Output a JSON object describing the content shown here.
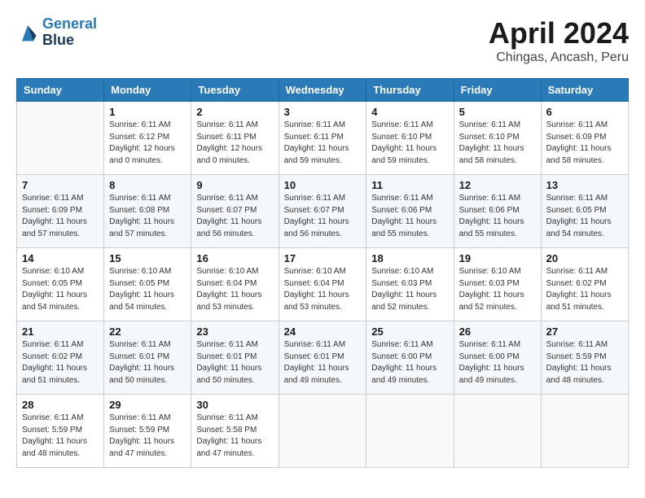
{
  "header": {
    "logo_line1": "General",
    "logo_line2": "Blue",
    "month": "April 2024",
    "location": "Chingas, Ancash, Peru"
  },
  "weekdays": [
    "Sunday",
    "Monday",
    "Tuesday",
    "Wednesday",
    "Thursday",
    "Friday",
    "Saturday"
  ],
  "weeks": [
    [
      {
        "day": "",
        "info": ""
      },
      {
        "day": "1",
        "info": "Sunrise: 6:11 AM\nSunset: 6:12 PM\nDaylight: 12 hours\nand 0 minutes."
      },
      {
        "day": "2",
        "info": "Sunrise: 6:11 AM\nSunset: 6:11 PM\nDaylight: 12 hours\nand 0 minutes."
      },
      {
        "day": "3",
        "info": "Sunrise: 6:11 AM\nSunset: 6:11 PM\nDaylight: 11 hours\nand 59 minutes."
      },
      {
        "day": "4",
        "info": "Sunrise: 6:11 AM\nSunset: 6:10 PM\nDaylight: 11 hours\nand 59 minutes."
      },
      {
        "day": "5",
        "info": "Sunrise: 6:11 AM\nSunset: 6:10 PM\nDaylight: 11 hours\nand 58 minutes."
      },
      {
        "day": "6",
        "info": "Sunrise: 6:11 AM\nSunset: 6:09 PM\nDaylight: 11 hours\nand 58 minutes."
      }
    ],
    [
      {
        "day": "7",
        "info": "Sunrise: 6:11 AM\nSunset: 6:09 PM\nDaylight: 11 hours\nand 57 minutes."
      },
      {
        "day": "8",
        "info": "Sunrise: 6:11 AM\nSunset: 6:08 PM\nDaylight: 11 hours\nand 57 minutes."
      },
      {
        "day": "9",
        "info": "Sunrise: 6:11 AM\nSunset: 6:07 PM\nDaylight: 11 hours\nand 56 minutes."
      },
      {
        "day": "10",
        "info": "Sunrise: 6:11 AM\nSunset: 6:07 PM\nDaylight: 11 hours\nand 56 minutes."
      },
      {
        "day": "11",
        "info": "Sunrise: 6:11 AM\nSunset: 6:06 PM\nDaylight: 11 hours\nand 55 minutes."
      },
      {
        "day": "12",
        "info": "Sunrise: 6:11 AM\nSunset: 6:06 PM\nDaylight: 11 hours\nand 55 minutes."
      },
      {
        "day": "13",
        "info": "Sunrise: 6:11 AM\nSunset: 6:05 PM\nDaylight: 11 hours\nand 54 minutes."
      }
    ],
    [
      {
        "day": "14",
        "info": "Sunrise: 6:10 AM\nSunset: 6:05 PM\nDaylight: 11 hours\nand 54 minutes."
      },
      {
        "day": "15",
        "info": "Sunrise: 6:10 AM\nSunset: 6:05 PM\nDaylight: 11 hours\nand 54 minutes."
      },
      {
        "day": "16",
        "info": "Sunrise: 6:10 AM\nSunset: 6:04 PM\nDaylight: 11 hours\nand 53 minutes."
      },
      {
        "day": "17",
        "info": "Sunrise: 6:10 AM\nSunset: 6:04 PM\nDaylight: 11 hours\nand 53 minutes."
      },
      {
        "day": "18",
        "info": "Sunrise: 6:10 AM\nSunset: 6:03 PM\nDaylight: 11 hours\nand 52 minutes."
      },
      {
        "day": "19",
        "info": "Sunrise: 6:10 AM\nSunset: 6:03 PM\nDaylight: 11 hours\nand 52 minutes."
      },
      {
        "day": "20",
        "info": "Sunrise: 6:11 AM\nSunset: 6:02 PM\nDaylight: 11 hours\nand 51 minutes."
      }
    ],
    [
      {
        "day": "21",
        "info": "Sunrise: 6:11 AM\nSunset: 6:02 PM\nDaylight: 11 hours\nand 51 minutes."
      },
      {
        "day": "22",
        "info": "Sunrise: 6:11 AM\nSunset: 6:01 PM\nDaylight: 11 hours\nand 50 minutes."
      },
      {
        "day": "23",
        "info": "Sunrise: 6:11 AM\nSunset: 6:01 PM\nDaylight: 11 hours\nand 50 minutes."
      },
      {
        "day": "24",
        "info": "Sunrise: 6:11 AM\nSunset: 6:01 PM\nDaylight: 11 hours\nand 49 minutes."
      },
      {
        "day": "25",
        "info": "Sunrise: 6:11 AM\nSunset: 6:00 PM\nDaylight: 11 hours\nand 49 minutes."
      },
      {
        "day": "26",
        "info": "Sunrise: 6:11 AM\nSunset: 6:00 PM\nDaylight: 11 hours\nand 49 minutes."
      },
      {
        "day": "27",
        "info": "Sunrise: 6:11 AM\nSunset: 5:59 PM\nDaylight: 11 hours\nand 48 minutes."
      }
    ],
    [
      {
        "day": "28",
        "info": "Sunrise: 6:11 AM\nSunset: 5:59 PM\nDaylight: 11 hours\nand 48 minutes."
      },
      {
        "day": "29",
        "info": "Sunrise: 6:11 AM\nSunset: 5:59 PM\nDaylight: 11 hours\nand 47 minutes."
      },
      {
        "day": "30",
        "info": "Sunrise: 6:11 AM\nSunset: 5:58 PM\nDaylight: 11 hours\nand 47 minutes."
      },
      {
        "day": "",
        "info": ""
      },
      {
        "day": "",
        "info": ""
      },
      {
        "day": "",
        "info": ""
      },
      {
        "day": "",
        "info": ""
      }
    ]
  ]
}
